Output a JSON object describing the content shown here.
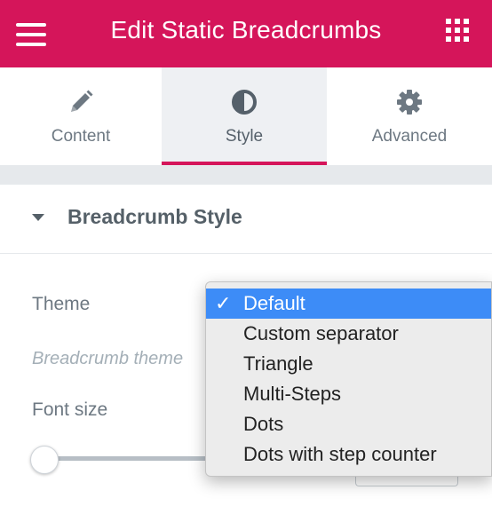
{
  "header": {
    "title": "Edit Static Breadcrumbs",
    "menu_icon": "hamburger-icon",
    "grid_icon": "apps-grid-icon",
    "bg_color": "#d5155a"
  },
  "tabs": [
    {
      "label": "Content",
      "icon": "pencil-icon",
      "active": false
    },
    {
      "label": "Style",
      "icon": "half-circle-contrast-icon",
      "active": true
    },
    {
      "label": "Advanced",
      "icon": "gear-icon",
      "active": false
    }
  ],
  "section": {
    "title": "Breadcrumb Style",
    "expanded": true
  },
  "controls": {
    "theme_label": "Theme",
    "theme_description": "Breadcrumb theme",
    "font_size_label": "Font size"
  },
  "dropdown": {
    "selected": "Default",
    "check_glyph": "✓",
    "options": [
      "Default",
      "Custom separator",
      "Triangle",
      "Multi-Steps",
      "Dots",
      "Dots with step counter"
    ],
    "highlight_color": "#3d8cf7"
  }
}
